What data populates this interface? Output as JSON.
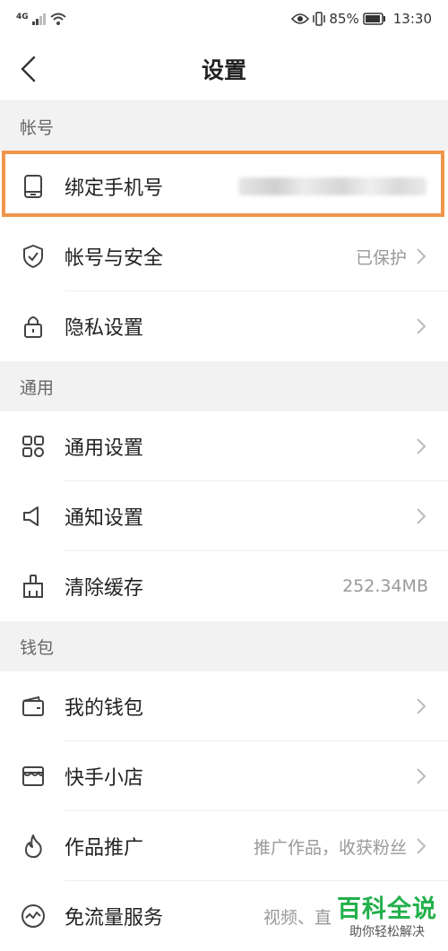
{
  "status_bar": {
    "network": "4G",
    "battery": "85%",
    "time": "13:30"
  },
  "header": {
    "title": "设置"
  },
  "sections": [
    {
      "title": "帐号"
    },
    {
      "title": "通用"
    },
    {
      "title": "钱包"
    }
  ],
  "account": {
    "bind_phone": {
      "label": "绑定手机号",
      "icon": "phone-icon"
    },
    "security": {
      "label": "帐号与安全",
      "value": "已保护",
      "icon": "shield-icon"
    },
    "privacy": {
      "label": "隐私设置",
      "icon": "lock-icon"
    }
  },
  "general": {
    "general_settings": {
      "label": "通用设置",
      "icon": "grid-icon"
    },
    "notifications": {
      "label": "通知设置",
      "icon": "speaker-icon"
    },
    "clear_cache": {
      "label": "清除缓存",
      "value": "252.34MB",
      "icon": "broom-icon"
    }
  },
  "wallet": {
    "my_wallet": {
      "label": "我的钱包",
      "icon": "wallet-icon"
    },
    "shop": {
      "label": "快手小店",
      "icon": "shop-icon"
    },
    "promotion": {
      "label": "作品推广",
      "value": "推广作品，收获粉丝",
      "icon": "flame-icon"
    },
    "free_data": {
      "label": "免流量服务",
      "value": "视频、直",
      "icon": "pulse-icon"
    }
  },
  "watermark": {
    "title": "百科全说",
    "subtitle": "助你轻松解决"
  },
  "colors": {
    "highlight": "#f0954a",
    "watermark": "#22b04b",
    "section_bg": "#f2f2f2"
  }
}
